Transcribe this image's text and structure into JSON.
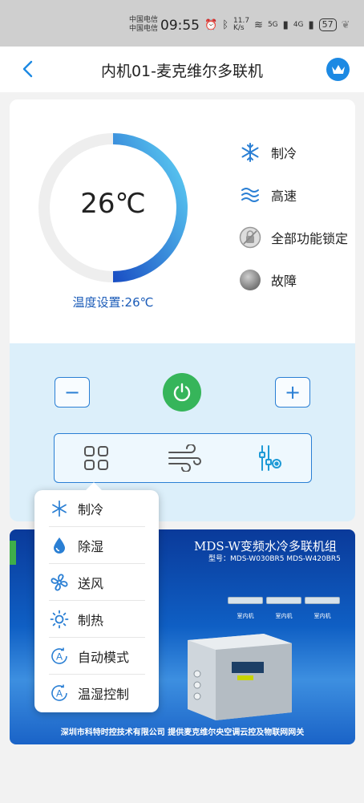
{
  "status_bar": {
    "carrier_1": "中国电信",
    "carrier_2": "中国电信",
    "time": "09:55",
    "speed_value": "11.7",
    "speed_unit": "K/s",
    "net_1": "5G",
    "net_2": "4G",
    "battery": "57"
  },
  "header": {
    "title": "内机01-麦克维尔多联机"
  },
  "thermostat": {
    "current_temp": "26℃",
    "setpoint_label": "温度设置:26℃",
    "ring_fraction": 0.5
  },
  "status": {
    "mode": "制冷",
    "fan_speed": "高速",
    "lock": "全部功能锁定",
    "fault": "故障"
  },
  "controls": {
    "minus": "−",
    "plus": "+"
  },
  "menu": {
    "items": [
      {
        "label": "制冷",
        "icon": "snowflake-icon"
      },
      {
        "label": "除湿",
        "icon": "droplet-icon"
      },
      {
        "label": "送风",
        "icon": "fan-icon"
      },
      {
        "label": "制热",
        "icon": "sun-icon"
      },
      {
        "label": "自动模式",
        "icon": "auto-a-icon"
      },
      {
        "label": "温湿控制",
        "icon": "auto-a-icon"
      }
    ]
  },
  "banner": {
    "title": "MDS-W变频水冷多联机组",
    "subtitle": "型号：MDS-W030BR5 MDS-W420BR5",
    "unit_caption": "室内机",
    "footer": "深圳市科特时控技术有限公司  提供麦克维尔央空调云控及物联网网关"
  },
  "colors": {
    "accent": "#2a7fd4",
    "power": "#36b55a",
    "ring_start": "#1a4fc4",
    "ring_end": "#5fd3f5"
  }
}
